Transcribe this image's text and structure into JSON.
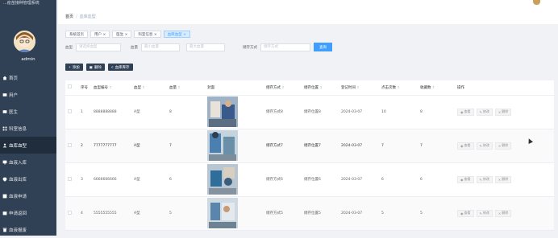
{
  "app": {
    "title": "...疫苗接种管理系统",
    "username": "admin"
  },
  "sidebar": {
    "items": [
      {
        "label": "首页",
        "icon": "home-icon"
      },
      {
        "label": "用户",
        "icon": "user-icon"
      },
      {
        "label": "医生",
        "icon": "doctor-icon"
      },
      {
        "label": "科室信息",
        "icon": "grid-icon"
      },
      {
        "label": "血库血型",
        "icon": "person-icon",
        "active": true
      },
      {
        "label": "血液入库",
        "icon": "monitor-icon"
      },
      {
        "label": "血液出库",
        "icon": "pin-icon"
      },
      {
        "label": "血液申请",
        "icon": "doc-icon"
      },
      {
        "label": "申请返回",
        "icon": "box-icon"
      },
      {
        "label": "血液报废",
        "icon": "trash-icon"
      }
    ]
  },
  "breadcrumb": {
    "home": "首页",
    "current": "血库血型"
  },
  "tabs": [
    {
      "label": "系统首页",
      "closable": false
    },
    {
      "label": "用户",
      "closable": true
    },
    {
      "label": "医生",
      "closable": true
    },
    {
      "label": "科室信息",
      "closable": true
    },
    {
      "label": "血库血型",
      "closable": true,
      "active": true
    }
  ],
  "filter": {
    "blood_type_label": "血型",
    "blood_type_placeholder": "请选择血型",
    "count_label": "血量",
    "min_placeholder": "最小血量",
    "max_placeholder": "最大血量",
    "storage_label": "储存方式",
    "storage_placeholder": "储存方式",
    "search_button": "查询"
  },
  "actions": {
    "add": "添加",
    "delete": "删除",
    "export": "血库库存"
  },
  "table": {
    "headers": [
      "序号",
      "血型编号",
      "血型",
      "血量",
      "封面",
      "储存方式",
      "储存位置",
      "登记时间",
      "点击次数",
      "收藏数",
      "操作"
    ],
    "rows": [
      {
        "idx": "1",
        "code": "8888888888",
        "type": "A型",
        "amount": "8",
        "storage": "储存方式8",
        "location": "储存位置8",
        "date": "2024-03-07",
        "clicks": "10",
        "fav": "8"
      },
      {
        "idx": "2",
        "code": "7777777777",
        "type": "A型",
        "amount": "7",
        "storage": "储存方式7",
        "location": "储存位置7",
        "date": "2024-03-07",
        "clicks": "7",
        "fav": "7"
      },
      {
        "idx": "3",
        "code": "6666666666",
        "type": "A型",
        "amount": "6",
        "storage": "储存方式6",
        "location": "储存位置6",
        "date": "2024-03-07",
        "clicks": "6",
        "fav": "6"
      },
      {
        "idx": "4",
        "code": "5555555555",
        "type": "A型",
        "amount": "5",
        "storage": "储存方式5",
        "location": "储存位置5",
        "date": "2024-03-07",
        "clicks": "5",
        "fav": "5"
      }
    ],
    "op_labels": {
      "view": "查看",
      "edit": "修改",
      "delete": "删除"
    }
  },
  "colors": {
    "sidebar": "#304156",
    "accent": "#409eff",
    "active_tab": "#d9ecff"
  }
}
